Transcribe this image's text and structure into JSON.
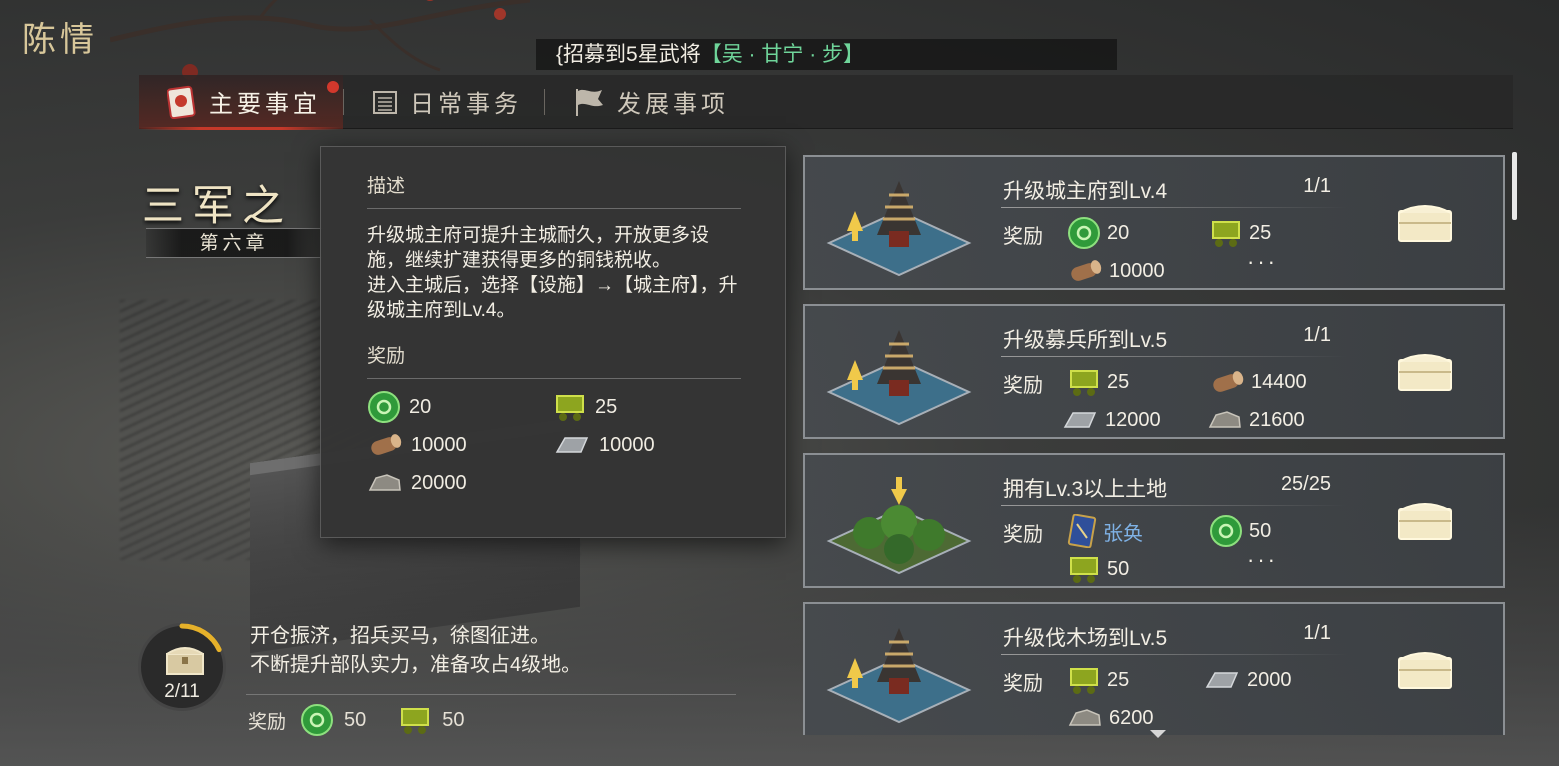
{
  "page_title": "陈情",
  "ticker": {
    "prefix": "{招募到5星武将",
    "highlight": "【吴 · 甘宁 · 步】"
  },
  "tabs": [
    {
      "label": "主要事宜",
      "icon": "document-icon",
      "active": true,
      "has_notification": true
    },
    {
      "label": "日常事务",
      "icon": "calendar-icon",
      "active": false
    },
    {
      "label": "发展事项",
      "icon": "flag-icon",
      "active": false
    }
  ],
  "chapter": {
    "title": "三军之",
    "subtitle": "第六章"
  },
  "popup": {
    "desc_title": "描述",
    "desc_line1": "升级城主府可提升主城耐久，开放更多设施，继续扩建获得更多的铜钱税收。",
    "desc_line2": "进入主城后，选择【设施】→【城主府】，升级城主府到Lv.4。",
    "reward_title": "奖励",
    "rewards": [
      {
        "icon": "jade-icon",
        "value": "20"
      },
      {
        "icon": "grain-cart-icon",
        "value": "25"
      },
      {
        "icon": "wood-log-icon",
        "value": "10000"
      },
      {
        "icon": "iron-ingot-icon",
        "value": "10000"
      },
      {
        "icon": "stone-icon",
        "value": "20000"
      }
    ]
  },
  "chapter_progress": {
    "count": "2/11",
    "fraction": 0.18,
    "story_line1": "开仓振济，招兵买马，徐图征进。",
    "story_line2": "不断提升部队实力，准备攻占4级地。",
    "reward_label": "奖励",
    "rewards": [
      {
        "icon": "jade-icon",
        "value": "50"
      },
      {
        "icon": "grain-cart-icon",
        "value": "50"
      }
    ]
  },
  "reward_label": "奖励",
  "tasks": [
    {
      "title": "升级城主府到Lv.4",
      "progress": "1/1",
      "thumb": "building-upgrade",
      "rewards": [
        {
          "icon": "jade-icon",
          "value": "20"
        },
        {
          "icon": "grain-cart-icon",
          "value": "25"
        },
        {
          "icon": "wood-log-icon",
          "value": "10000"
        }
      ],
      "more": "···"
    },
    {
      "title": "升级募兵所到Lv.5",
      "progress": "1/1",
      "thumb": "building-upgrade",
      "rewards": [
        {
          "icon": "grain-cart-icon",
          "value": "25"
        },
        {
          "icon": "wood-log-icon",
          "value": "14400"
        },
        {
          "icon": "iron-ingot-icon",
          "value": "12000"
        },
        {
          "icon": "stone-icon",
          "value": "21600"
        }
      ]
    },
    {
      "title": "拥有Lv.3以上土地",
      "progress": "25/25",
      "thumb": "forest-land",
      "rewards": [
        {
          "icon": "hero-card-icon",
          "value": "张奂"
        },
        {
          "icon": "jade-icon",
          "value": "50"
        },
        {
          "icon": "grain-cart-icon",
          "value": "50"
        }
      ],
      "more": "···"
    },
    {
      "title": "升级伐木场到Lv.5",
      "progress": "1/1",
      "thumb": "building-upgrade",
      "rewards": [
        {
          "icon": "grain-cart-icon",
          "value": "25"
        },
        {
          "icon": "iron-ingot-icon",
          "value": "2000"
        },
        {
          "icon": "stone-icon",
          "value": "6200"
        }
      ]
    }
  ]
}
